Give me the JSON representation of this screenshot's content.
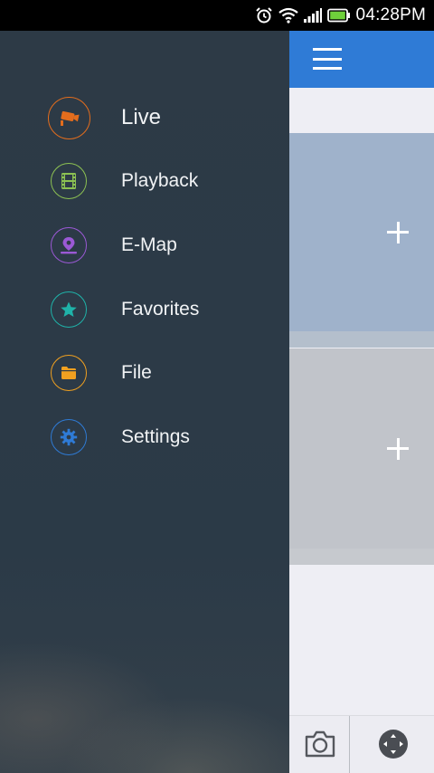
{
  "status_bar": {
    "time": "04:28PM",
    "icons": [
      "alarm-icon",
      "wifi-icon",
      "signal-icon",
      "battery-icon"
    ]
  },
  "drawer": {
    "items": [
      {
        "label": "Live",
        "icon": "camera-icon",
        "color": "#e36d1d",
        "active": true
      },
      {
        "label": "Playback",
        "icon": "film-icon",
        "color": "#8cc152",
        "active": false
      },
      {
        "label": "E-Map",
        "icon": "map-pin-icon",
        "color": "#9b59d6",
        "active": false
      },
      {
        "label": "Favorites",
        "icon": "star-icon",
        "color": "#1fb3a9",
        "active": false
      },
      {
        "label": "File",
        "icon": "folder-icon",
        "color": "#f0a020",
        "active": false
      },
      {
        "label": "Settings",
        "icon": "gear-icon",
        "color": "#2f7bd6",
        "active": false
      }
    ]
  },
  "main": {
    "appbar_color": "#2f7bd6",
    "menu_icon": "hamburger-icon",
    "panes": [
      {
        "icon": "plus-icon"
      },
      {
        "icon": "plus-icon"
      }
    ],
    "bottom_bar": {
      "buttons": [
        "camera-snapshot-icon",
        "ptz-control-icon"
      ]
    }
  }
}
